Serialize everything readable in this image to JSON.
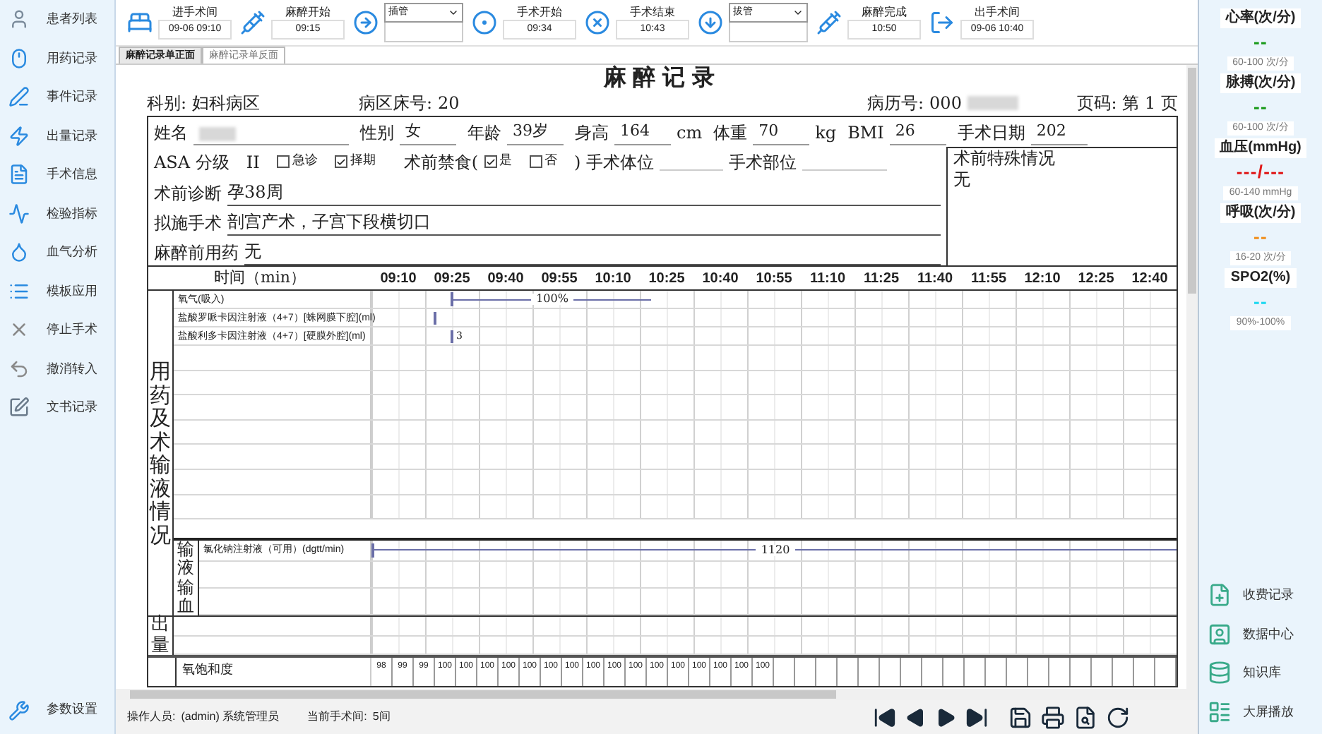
{
  "sidebar": {
    "items": [
      {
        "label": "患者列表"
      },
      {
        "label": "用药记录"
      },
      {
        "label": "事件记录"
      },
      {
        "label": "出量记录"
      },
      {
        "label": "手术信息"
      },
      {
        "label": "检验指标"
      },
      {
        "label": "血气分析"
      },
      {
        "label": "模板应用"
      },
      {
        "label": "停止手术"
      },
      {
        "label": "撤消转入"
      },
      {
        "label": "文书记录"
      }
    ],
    "footer_item": {
      "label": "参数设置"
    }
  },
  "toolbar": {
    "steps": [
      {
        "kind": "time",
        "label": "进手术间",
        "value": "09-06 09:10"
      },
      {
        "kind": "time",
        "label": "麻醉开始",
        "value": "09:15"
      },
      {
        "kind": "select",
        "value": "插管"
      },
      {
        "kind": "time",
        "label": "手术开始",
        "value": "09:34"
      },
      {
        "kind": "time",
        "label": "手术结束",
        "value": "10:43"
      },
      {
        "kind": "select",
        "value": "拔管"
      },
      {
        "kind": "time",
        "label": "麻醉完成",
        "value": "10:50"
      },
      {
        "kind": "time",
        "label": "出手术间",
        "value": "09-06 10:40"
      }
    ]
  },
  "tabs": [
    {
      "label": "麻醉记录单正面",
      "selected": true
    },
    {
      "label": "麻醉记录单反面",
      "selected": false
    }
  ],
  "record": {
    "title": "麻醉记录",
    "header": [
      {
        "label": "科别:",
        "value": "妇科病区"
      },
      {
        "label": "病区床号:",
        "value": "20"
      },
      {
        "label": "病历号:",
        "value": "000",
        "redacted": true
      },
      {
        "label": "页码:",
        "value": "第 1 页"
      }
    ],
    "patient": [
      {
        "label": "姓名",
        "redacted": true
      },
      {
        "label": "性别",
        "value": "女"
      },
      {
        "label": "年龄",
        "value": "39岁"
      },
      {
        "label": "身高",
        "value": "164",
        "unit": "cm"
      },
      {
        "label": "体重",
        "value": "70",
        "unit": "kg"
      },
      {
        "label": "BMI",
        "value": "26"
      },
      {
        "label": "手术日期",
        "value": "202"
      }
    ],
    "asa": {
      "label": "ASA 分级",
      "value": "II",
      "options": [
        {
          "label": "急诊",
          "checked": false
        },
        {
          "label": "择期",
          "checked": true
        }
      ]
    },
    "fasting": {
      "label": "术前禁食(",
      "options": [
        {
          "label": "是",
          "checked": true
        },
        {
          "label": "否",
          "checked": false
        }
      ],
      "suffix": ")"
    },
    "position": {
      "label": "手术体位"
    },
    "site": {
      "label": "手术部位"
    },
    "lines": [
      {
        "label": "术前诊断",
        "value": "孕38周"
      },
      {
        "label": "拟施手术",
        "value": "剖宫产术，子宫下段横切口"
      },
      {
        "label": "麻醉前用药",
        "value": "无"
      }
    ],
    "special": {
      "label": "术前特殊情况",
      "value": "无"
    },
    "timeline": {
      "label": "时间（min）",
      "times": [
        "09:10",
        "09:25",
        "09:40",
        "09:55",
        "10:10",
        "10:25",
        "10:40",
        "10:55",
        "11:10",
        "11:25",
        "11:40",
        "11:55",
        "12:10",
        "12:25",
        "12:40"
      ]
    },
    "section_label": "用药及术输液情况",
    "drugs": [
      {
        "kind": "continuous",
        "name": "氧气(吸入)",
        "dose": "100%"
      },
      {
        "kind": "bolus",
        "name": "盐酸罗哌卡因注射液（4+7）[蛛网膜下腔](ml)"
      },
      {
        "kind": "bolus",
        "name": "盐酸利多卡因注射液（4+7）[硬膜外腔](ml)",
        "dose": "3"
      }
    ],
    "infusion": {
      "label": "输液输血",
      "items": [
        {
          "kind": "continuous",
          "name": "氯化钠注射液（可用）(dgtt/min)",
          "dose": "1120"
        }
      ]
    },
    "output": {
      "label": "出量"
    },
    "spo2_row": {
      "label": "氧饱和度",
      "values": [
        "98",
        "99",
        "99",
        "100",
        "100",
        "100",
        "100",
        "100",
        "100",
        "100",
        "100",
        "100",
        "100",
        "100",
        "100",
        "100",
        "100",
        "100",
        "100"
      ]
    }
  },
  "vitals": [
    {
      "label": "心率(次/分)",
      "reading": "--",
      "range": "60-100 次/分",
      "color": "#1a9a1a"
    },
    {
      "label": "脉搏(次/分)",
      "reading": "--",
      "range": "60-100 次/分",
      "color": "#1a9a1a"
    },
    {
      "label": "血压(mmHg)",
      "reading": "---/---",
      "range": "60-140 mmHg",
      "color": "#e01818"
    },
    {
      "label": "呼吸(次/分)",
      "reading": "--",
      "range": "16-20 次/分",
      "color": "#f09020"
    },
    {
      "label": "SPO2(%)",
      "reading": "--",
      "range": "90%-100%",
      "color": "#20d8f0"
    }
  ],
  "actions": [
    {
      "label": "收费记录"
    },
    {
      "label": "数据中心"
    },
    {
      "label": "知识库"
    },
    {
      "label": "大屏播放"
    }
  ],
  "status_bar": {
    "operator_label": "操作人员:",
    "operator": "(admin) 系统管理员",
    "room_label": "当前手术间:",
    "room": "5间"
  }
}
